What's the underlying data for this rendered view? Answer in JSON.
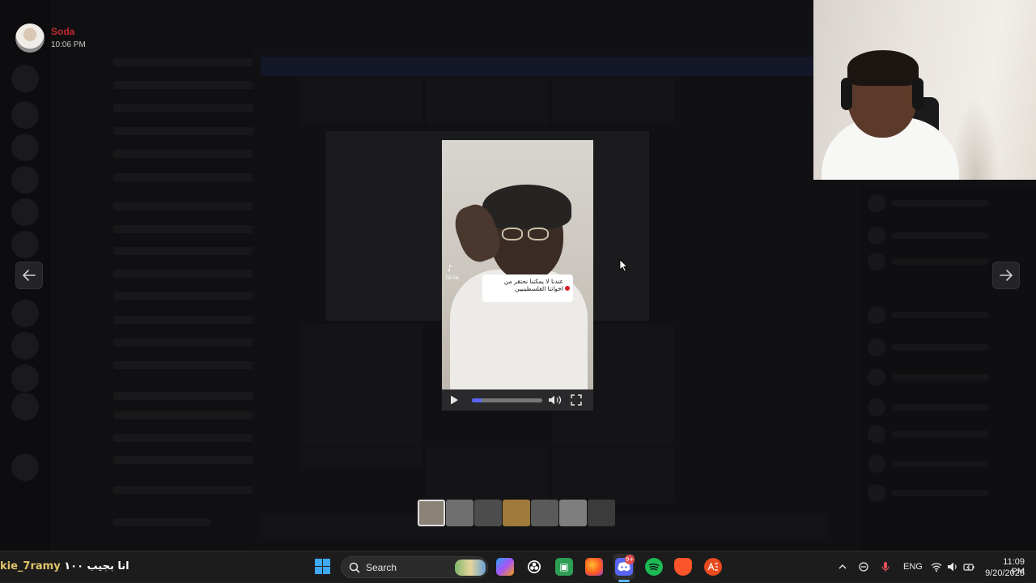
{
  "profile": {
    "name": "Soda",
    "time": "10:06 PM"
  },
  "viewer": {
    "caption": "عندنا لا يمكننا نحتقر من اخواتنا الفلسطينيين",
    "tiktok_label": "TikTok",
    "progress": 0.14
  },
  "thumbnails": {
    "count": 7,
    "active_index": 0,
    "colors": [
      "#8a8276",
      "#6f6f6f",
      "#4c4c4c",
      "#a07a3a",
      "#5a5a5a",
      "#7e7e7e",
      "#3b3b3b"
    ]
  },
  "taskbar": {
    "overlay_user": "kie_7ramy",
    "overlay_message": "انا بجيب ١٠٠",
    "search_label": "Search",
    "language": "ENG",
    "discord_badge": "9+",
    "time": "11:09 PM",
    "date": "9/20/2025"
  },
  "colors": {
    "accent": "#5865f2",
    "profile_name": "#c0292d",
    "windows_blue": "#3fa9f5"
  }
}
